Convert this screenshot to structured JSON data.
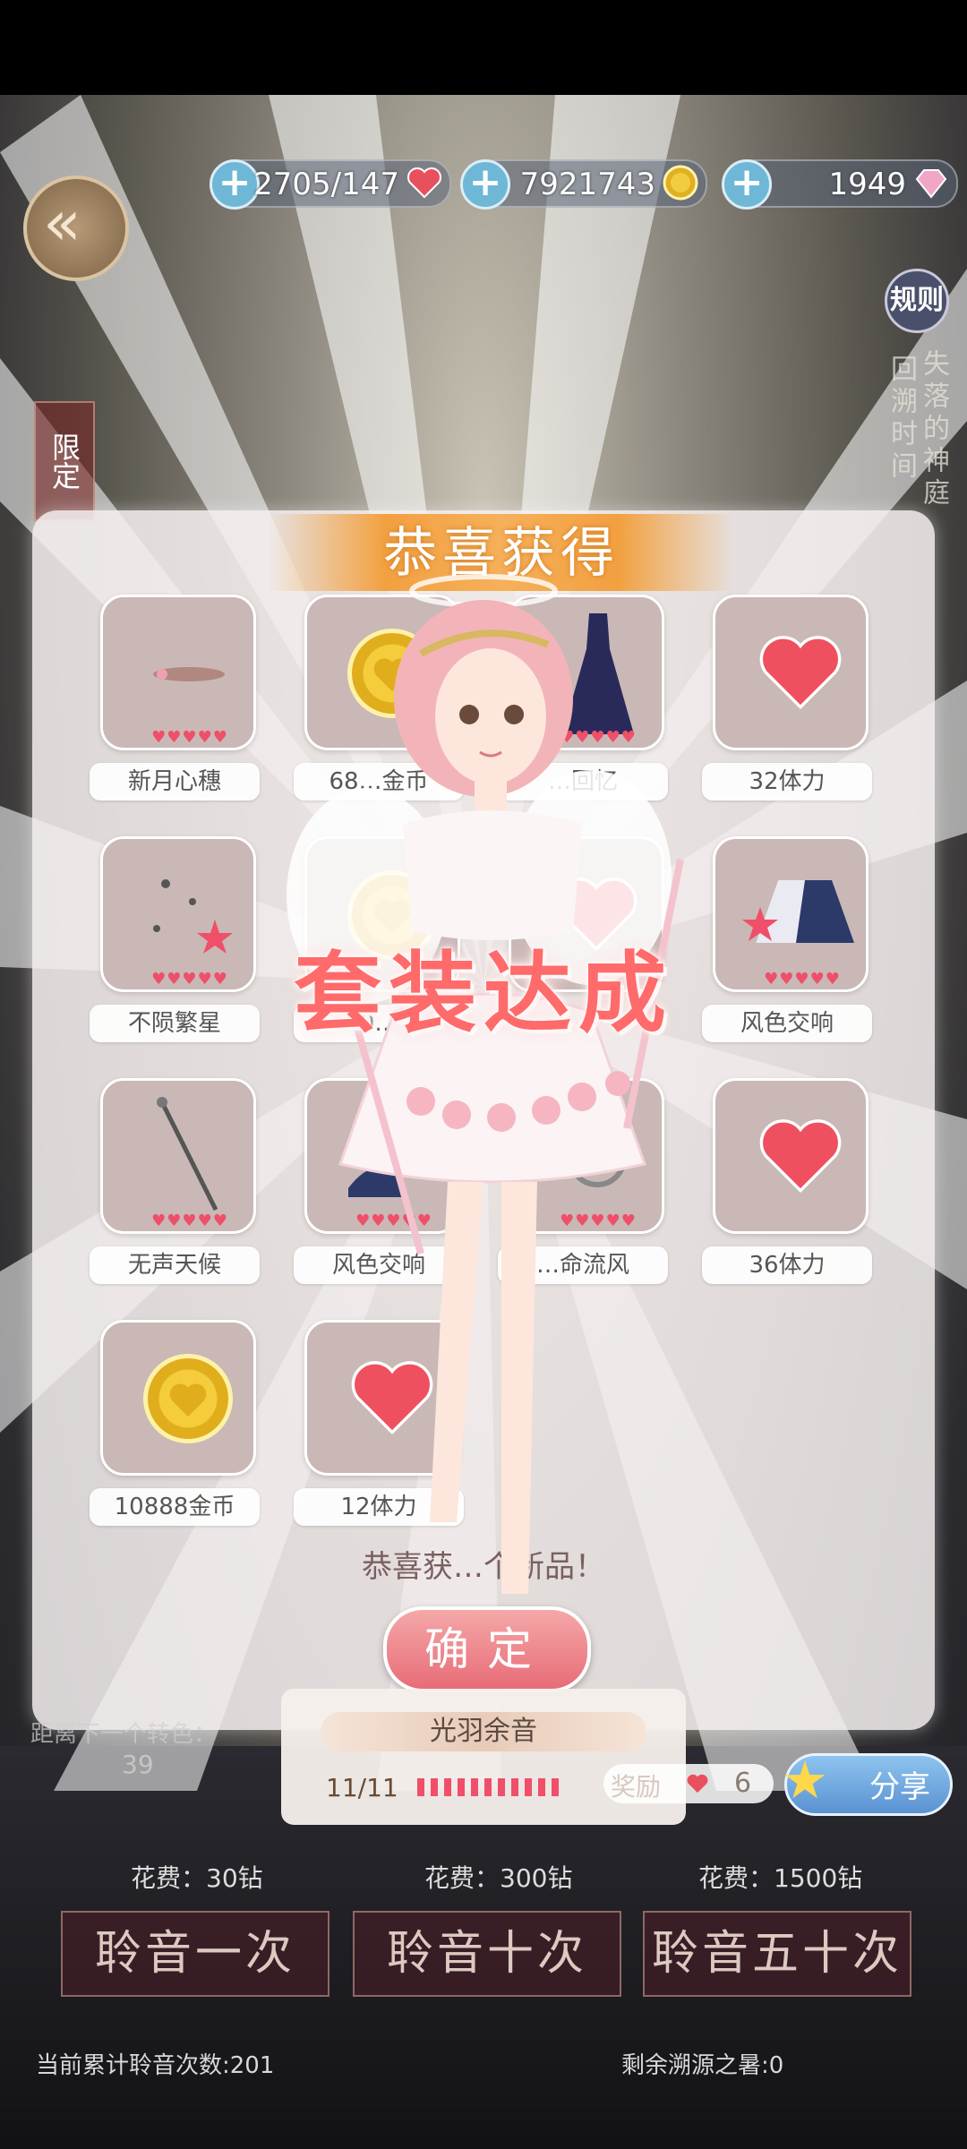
{
  "resources": [
    {
      "value": "2705/147",
      "icon": "heart-icon",
      "color": "#e8505e"
    },
    {
      "value": "7921743",
      "icon": "gold-coin-icon",
      "color": "#e0b020"
    },
    {
      "value": "1949",
      "icon": "diamond-icon",
      "color": "#f0a0c0"
    }
  ],
  "rules_label": "规则",
  "side_text_right_1": "失落的神庭",
  "side_text_right_2": "回溯时间",
  "side_limit_label": "限定",
  "popup": {
    "title": "恭喜获得",
    "items": [
      {
        "label": "新月心穗",
        "rarity": 5,
        "icon": "hairpin-icon"
      },
      {
        "label": "68…金币",
        "rarity": 0,
        "icon": "gold-coin-icon"
      },
      {
        "label": "…回忆",
        "rarity": 5,
        "icon": "dress-icon"
      },
      {
        "label": "32体力",
        "rarity": 0,
        "icon": "heart-icon"
      },
      {
        "label": "不陨繁星",
        "rarity": 5,
        "icon": "stars-makeup-icon"
      },
      {
        "label": "10…8",
        "rarity": 0,
        "icon": "gold-coin-icon"
      },
      {
        "label": "",
        "rarity": 0,
        "icon": "heart-icon"
      },
      {
        "label": "风色交响",
        "rarity": 5,
        "icon": "cape-icon"
      },
      {
        "label": "无声天候",
        "rarity": 5,
        "icon": "staff-icon"
      },
      {
        "label": "风色交响",
        "rarity": 5,
        "icon": "shoes-icon"
      },
      {
        "label": "…命流风",
        "rarity": 5,
        "icon": "accessory-icon"
      },
      {
        "label": "36体力",
        "rarity": 0,
        "icon": "heart-icon"
      },
      {
        "label": "10888金币",
        "rarity": 0,
        "icon": "gold-coin-icon"
      },
      {
        "label": "12体力",
        "rarity": 0,
        "icon": "heart-icon"
      }
    ],
    "congrats_text": "恭喜获…个新品！",
    "confirm_label": "确定"
  },
  "suit_complete_text": "套装达成",
  "suit_progress": {
    "name": "光羽余音",
    "count_text": "11/11",
    "collected": 11,
    "total": 11
  },
  "reward": {
    "label": "奖励",
    "count": "6",
    "icon": "heart-icon"
  },
  "share_label": "分享",
  "next_color_text": "距离下一个转色：",
  "next_color_value": "39",
  "pulls": [
    {
      "cost": "花费：30钻",
      "label": "聆音一次"
    },
    {
      "cost": "花费：300钻",
      "label": "聆音十次"
    },
    {
      "cost": "花费：1500钻",
      "label": "聆音五十次"
    }
  ],
  "footer": {
    "total_pulls": "当前累计聆音次数:201",
    "remaining": "剩余溯源之暑:0"
  }
}
